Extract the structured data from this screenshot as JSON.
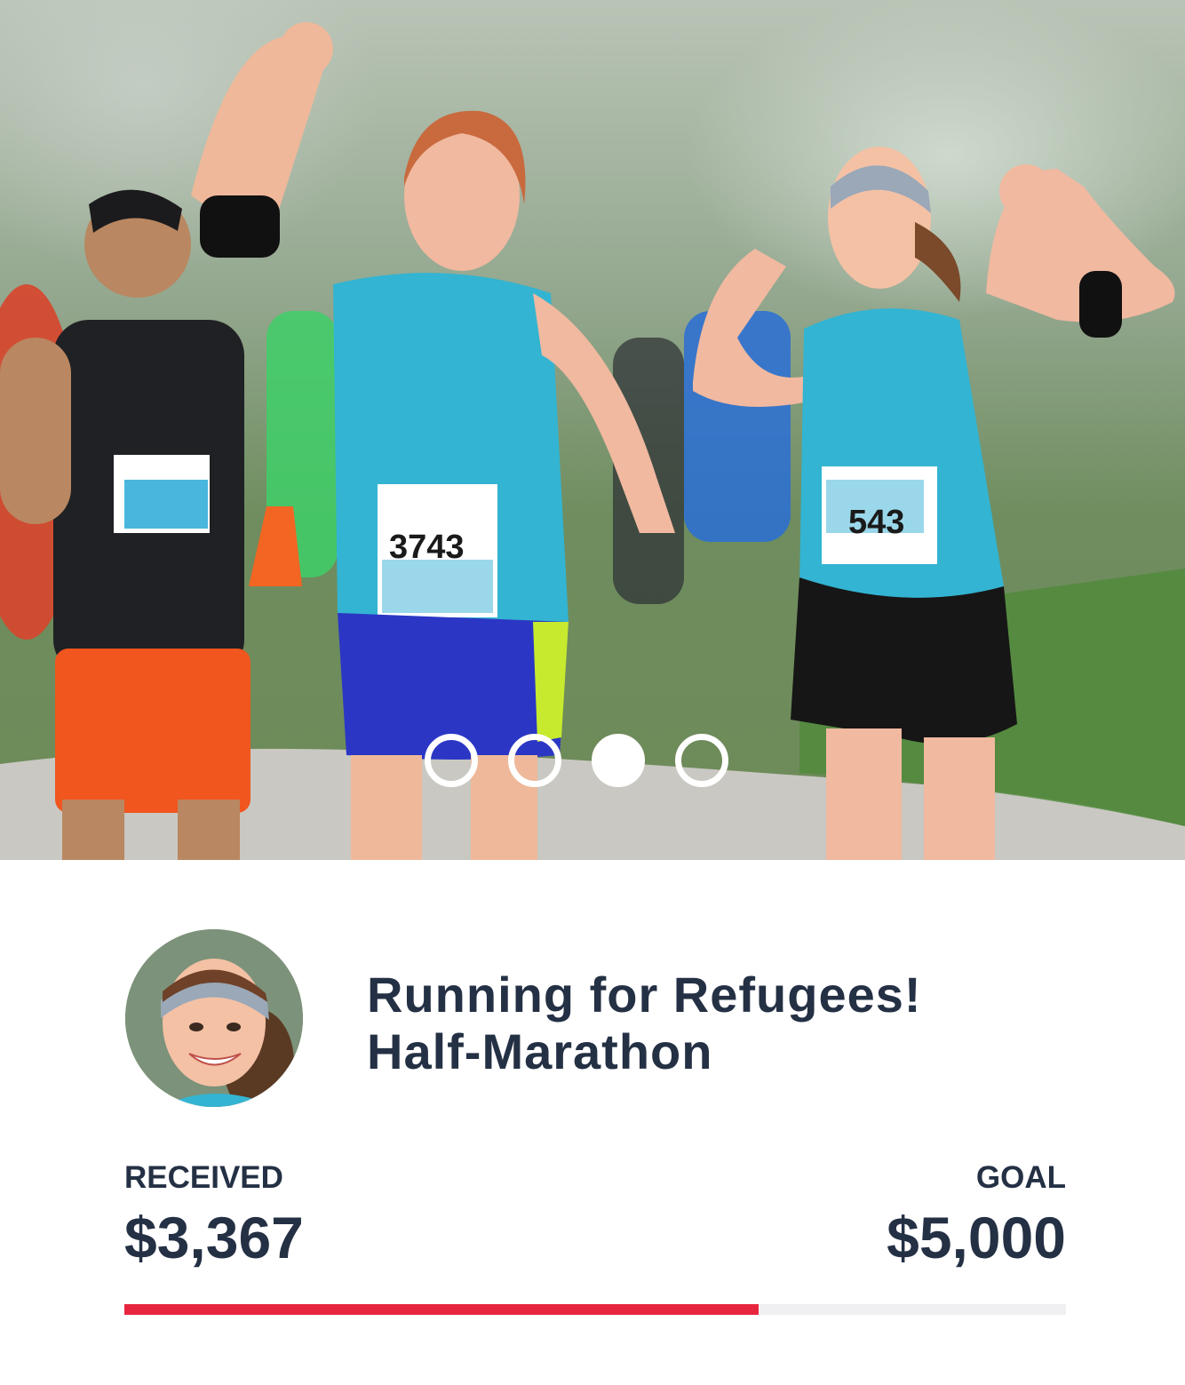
{
  "carousel": {
    "slide_count": 4,
    "active_index": 2,
    "photo": {
      "bib_numbers": [
        "3743",
        "543"
      ]
    }
  },
  "campaign": {
    "title_line1": "Running for Refugees!",
    "title_line2": "Half-Marathon"
  },
  "stats": {
    "received_label": "RECEIVED",
    "received_value": "$3,367",
    "goal_label": "GOAL",
    "goal_value": "$5,000",
    "progress_fraction": 0.6734
  },
  "colors": {
    "progress_fill": "#e8253e",
    "progress_track": "#f0f0f2",
    "text": "#243044"
  }
}
